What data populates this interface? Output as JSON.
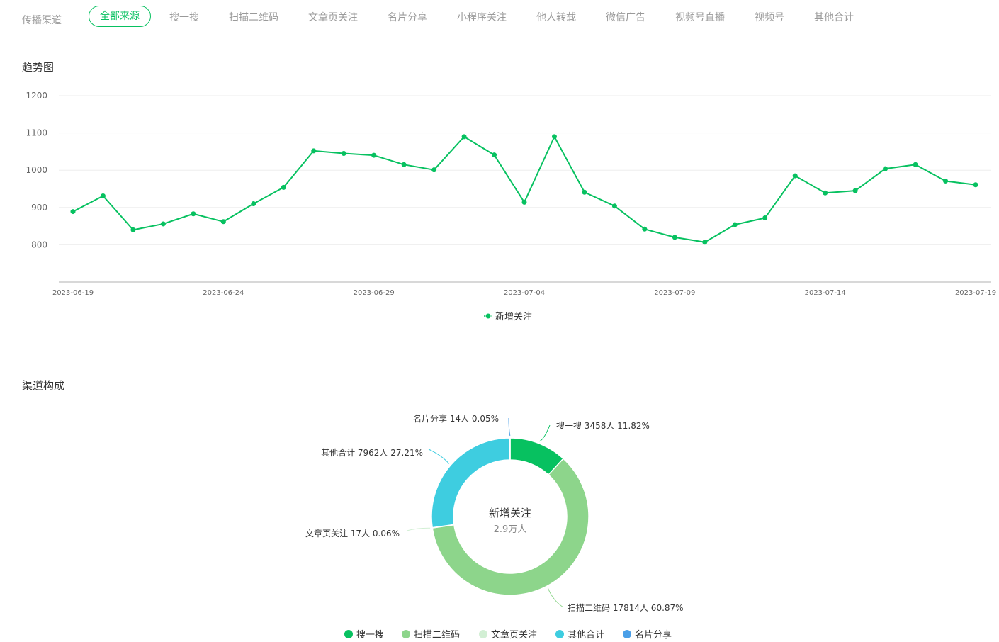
{
  "filter": {
    "label": "传播渠道",
    "tabs": [
      "全部来源",
      "搜一搜",
      "扫描二维码",
      "文章页关注",
      "名片分享",
      "小程序关注",
      "他人转载",
      "微信广告",
      "视频号直播",
      "视频号",
      "其他合计"
    ],
    "active_index": 0
  },
  "colors": {
    "accent": "#07c160",
    "grid": "#eeeeee",
    "axis": "#cccccc"
  },
  "trend": {
    "section_title": "趋势图"
  },
  "composition": {
    "section_title": "渠道构成"
  },
  "chart_data": [
    {
      "type": "line",
      "y_ticks": [
        800,
        900,
        1000,
        1100,
        1200
      ],
      "x_tick_labels": [
        "2023-06-19",
        "2023-06-24",
        "2023-06-29",
        "2023-07-04",
        "2023-07-09",
        "2023-07-14",
        "2023-07-19"
      ],
      "x": [
        "2023-06-19",
        "2023-06-20",
        "2023-06-21",
        "2023-06-22",
        "2023-06-23",
        "2023-06-24",
        "2023-06-25",
        "2023-06-26",
        "2023-06-27",
        "2023-06-28",
        "2023-06-29",
        "2023-06-30",
        "2023-07-01",
        "2023-07-02",
        "2023-07-03",
        "2023-07-04",
        "2023-07-05",
        "2023-07-06",
        "2023-07-07",
        "2023-07-08",
        "2023-07-09",
        "2023-07-10",
        "2023-07-11",
        "2023-07-12",
        "2023-07-13",
        "2023-07-14",
        "2023-07-15",
        "2023-07-16",
        "2023-07-17",
        "2023-07-18",
        "2023-07-19"
      ],
      "series": [
        {
          "name": "新增关注",
          "color": "#07c160",
          "values": [
            889,
            931,
            840,
            856,
            883,
            862,
            910,
            954,
            1052,
            1045,
            1040,
            1015,
            1001,
            1090,
            1041,
            914,
            1090,
            941,
            904,
            842,
            820,
            807,
            854,
            872,
            985,
            939,
            945,
            1004,
            1015,
            971,
            961
          ]
        }
      ],
      "ylim": [
        700,
        1200
      ],
      "grid": true,
      "legend_position": "bottom-center"
    },
    {
      "type": "pie",
      "center_title": "新增关注",
      "center_value": "2.9万人",
      "slices": [
        {
          "name": "搜一搜",
          "value": 3458,
          "label": "搜一搜 3458人 11.82%",
          "color": "#07c160"
        },
        {
          "name": "扫描二维码",
          "value": 17814,
          "label": "扫描二维码 17814人 60.87%",
          "color": "#8dd58b"
        },
        {
          "name": "文章页关注",
          "value": 17,
          "label": "文章页关注 17人 0.06%",
          "color": "#d2efd4"
        },
        {
          "name": "其他合计",
          "value": 7962,
          "label": "其他合计 7962人 27.21%",
          "color": "#3ecde0"
        },
        {
          "name": "名片分享",
          "value": 14,
          "label": "名片分享 14人 0.05%",
          "color": "#4a9fe8"
        }
      ],
      "legend_position": "bottom-center"
    }
  ]
}
